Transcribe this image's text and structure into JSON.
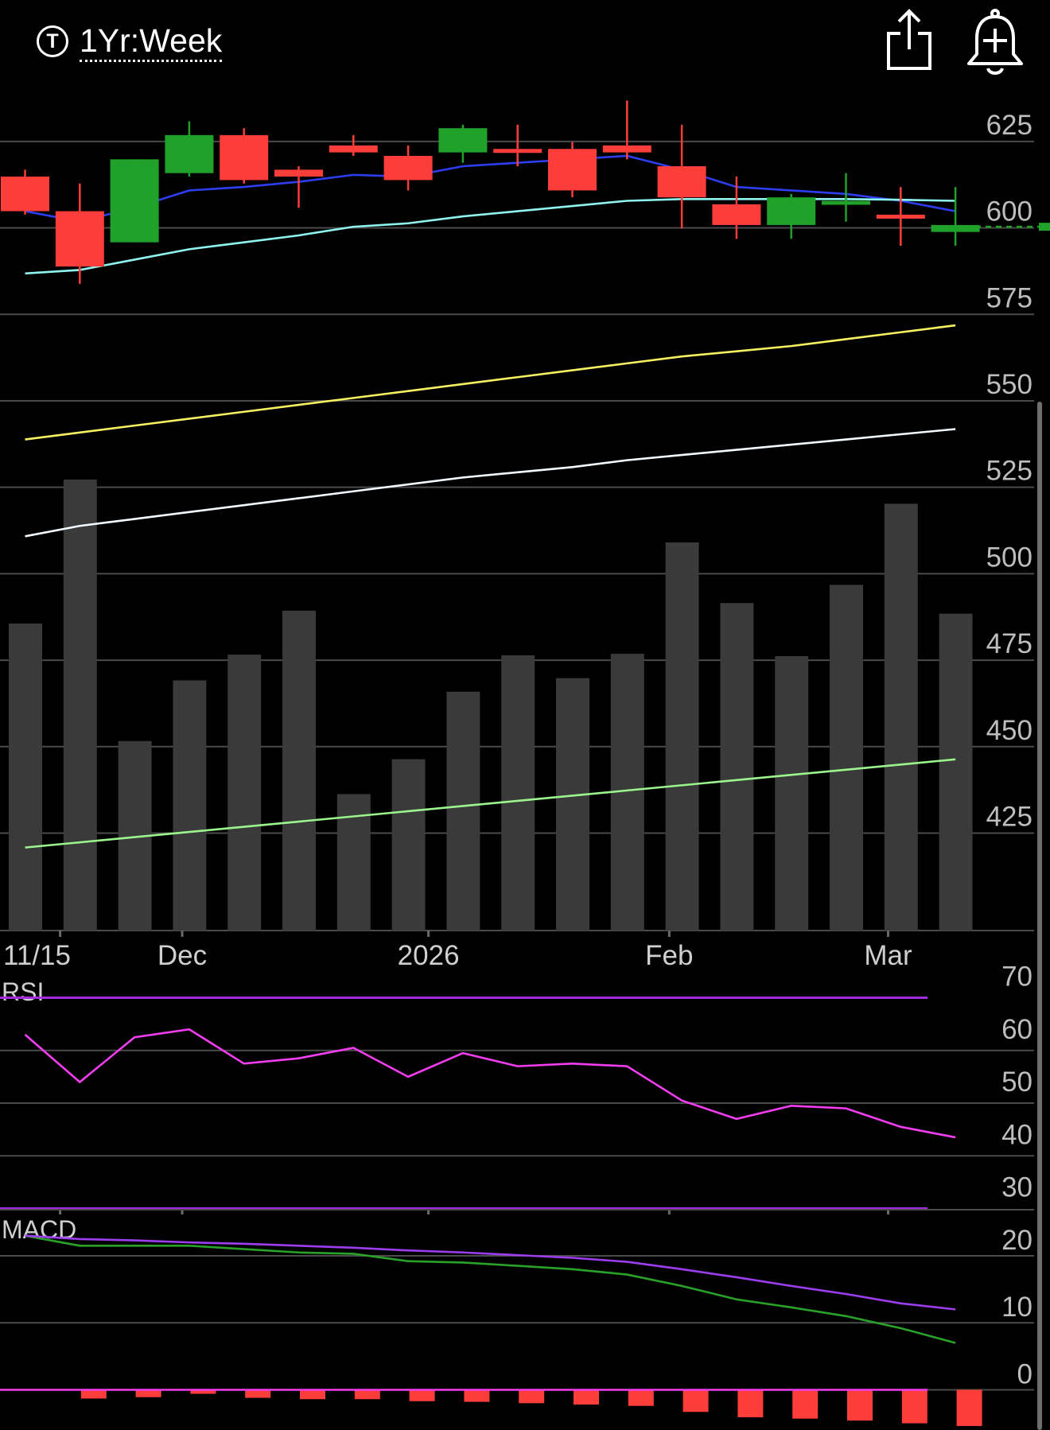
{
  "header": {
    "range_label": "1Yr:Week",
    "range_icon_glyph": "T",
    "share_icon": "share-icon",
    "alert_icon": "bell-plus-icon"
  },
  "colors": {
    "up": "#1fa12a",
    "down": "#fc3d39",
    "volume": "#3a3a3a",
    "ma_fast": "#2c3ef0",
    "ma_mid": "#8ff3f0",
    "ma_50": "#f7f060",
    "ma_100": "#f2fbff",
    "ma_200": "#9cf58c",
    "rsi": "#f23df0",
    "rsi_band": "#a22be0",
    "macd_line": "#28a228",
    "macd_signal": "#9d3df0",
    "macd_hist": "#fc3d39"
  },
  "chart_data": [
    {
      "type": "candlestick",
      "pane": "price",
      "y_ticks": [
        625,
        600,
        575,
        550,
        525,
        500,
        475,
        450,
        425
      ],
      "ylim": [
        392,
        636
      ],
      "x_labels": [
        {
          "index": 0.67,
          "label": "11/15"
        },
        {
          "index": 2.9,
          "label": "Dec"
        },
        {
          "index": 7.4,
          "label": "2026"
        },
        {
          "index": 11.8,
          "label": "Feb"
        },
        {
          "index": 15.8,
          "label": "Mar"
        }
      ],
      "candles": [
        {
          "open": 610,
          "close": 600,
          "high": 612,
          "low": 599
        },
        {
          "open": 600,
          "close": 584,
          "high": 608,
          "low": 579
        },
        {
          "open": 591,
          "close": 615,
          "high": 615,
          "low": 591
        },
        {
          "open": 611,
          "close": 622,
          "high": 626,
          "low": 610
        },
        {
          "open": 622,
          "close": 609,
          "high": 624,
          "low": 608
        },
        {
          "open": 612,
          "close": 610,
          "high": 613,
          "low": 601
        },
        {
          "open": 619,
          "close": 617,
          "high": 622,
          "low": 616
        },
        {
          "open": 616,
          "close": 609,
          "high": 619,
          "low": 606
        },
        {
          "open": 617,
          "close": 624,
          "high": 625,
          "low": 614
        },
        {
          "open": 618,
          "close": 617,
          "high": 625,
          "low": 613
        },
        {
          "open": 618,
          "close": 606,
          "high": 620,
          "low": 604
        },
        {
          "open": 619,
          "close": 617,
          "high": 632,
          "low": 615
        },
        {
          "open": 613,
          "close": 604,
          "high": 625,
          "low": 595
        },
        {
          "open": 602,
          "close": 596,
          "high": 610,
          "low": 592
        },
        {
          "open": 596,
          "close": 604,
          "high": 605,
          "low": 592
        },
        {
          "open": 603,
          "close": 603,
          "high": 611,
          "low": 597
        },
        {
          "open": 599,
          "close": 598,
          "high": 607,
          "low": 590
        },
        {
          "open": 594,
          "close": 596,
          "high": 607,
          "low": 590
        }
      ],
      "last_price": 595.5,
      "moving_averages": [
        {
          "key": "ma_fast",
          "values": [
            600,
            597,
            601,
            606,
            607,
            608.5,
            610.5,
            610,
            613,
            614,
            615,
            616,
            612,
            607,
            606,
            605,
            603,
            600
          ]
        },
        {
          "key": "ma_mid",
          "values": [
            582,
            583,
            586,
            589,
            591,
            593,
            595.5,
            596.5,
            598.5,
            600,
            601.5,
            603,
            603.5,
            603.5,
            603.5,
            603.5,
            603.3,
            603
          ]
        },
        {
          "key": "ma_50",
          "values": [
            534,
            536,
            538,
            540,
            542,
            544,
            546,
            548,
            550,
            552,
            554,
            556,
            558,
            559.5,
            561,
            563,
            565,
            567
          ]
        },
        {
          "key": "ma_100",
          "values": [
            506,
            509,
            511,
            513,
            515,
            517,
            519,
            521,
            523,
            524.5,
            526,
            528,
            529.5,
            531,
            532.5,
            534,
            535.5,
            537
          ]
        },
        {
          "key": "ma_200",
          "values": [
            416,
            417.5,
            419,
            420.5,
            422,
            423.5,
            425,
            426.5,
            428,
            429.5,
            431,
            432.5,
            434,
            435.5,
            437,
            438.5,
            440,
            441.5
          ]
        }
      ]
    },
    {
      "type": "bar",
      "pane": "volume",
      "values": [
        405,
        595,
        250,
        330,
        364,
        422,
        180,
        226,
        315,
        363,
        333,
        365,
        512,
        432,
        362,
        456,
        563,
        418
      ]
    },
    {
      "type": "line",
      "pane": "rsi",
      "title": "RSI",
      "y_ticks": [
        70,
        60,
        50,
        40,
        30
      ],
      "ylim": [
        26,
        74
      ],
      "bands": [
        70,
        30
      ],
      "values": [
        63,
        54,
        62.5,
        64,
        57.5,
        58.5,
        60.5,
        55,
        59.5,
        57,
        57.5,
        57,
        50.5,
        47,
        49.5,
        49,
        45.5,
        43.5
      ]
    },
    {
      "type": "line",
      "pane": "macd",
      "title": "MACD",
      "y_ticks": [
        20,
        10,
        0
      ],
      "ylim": [
        -6,
        27
      ],
      "series": [
        {
          "key": "macd_line",
          "values": [
            23,
            21.5,
            21.5,
            21.5,
            21,
            20.5,
            20.3,
            19.2,
            19,
            18.5,
            18,
            17.2,
            15.5,
            13.5,
            12.3,
            11,
            9.2,
            7
          ]
        },
        {
          "key": "macd_signal",
          "values": [
            23,
            22.5,
            22.3,
            22,
            21.8,
            21.5,
            21.2,
            20.8,
            20.5,
            20.1,
            19.7,
            19.1,
            18,
            16.8,
            15.5,
            14.3,
            12.9,
            12
          ]
        },
        {
          "key": "macd_hist",
          "values": [
            0,
            -1.3,
            -1.1,
            -0.6,
            -1.2,
            -1.4,
            -1.4,
            -1.7,
            -1.8,
            -2,
            -2.2,
            -2.4,
            -3.3,
            -4.1,
            -4.3,
            -4.6,
            -5,
            -5.4
          ]
        }
      ]
    }
  ]
}
